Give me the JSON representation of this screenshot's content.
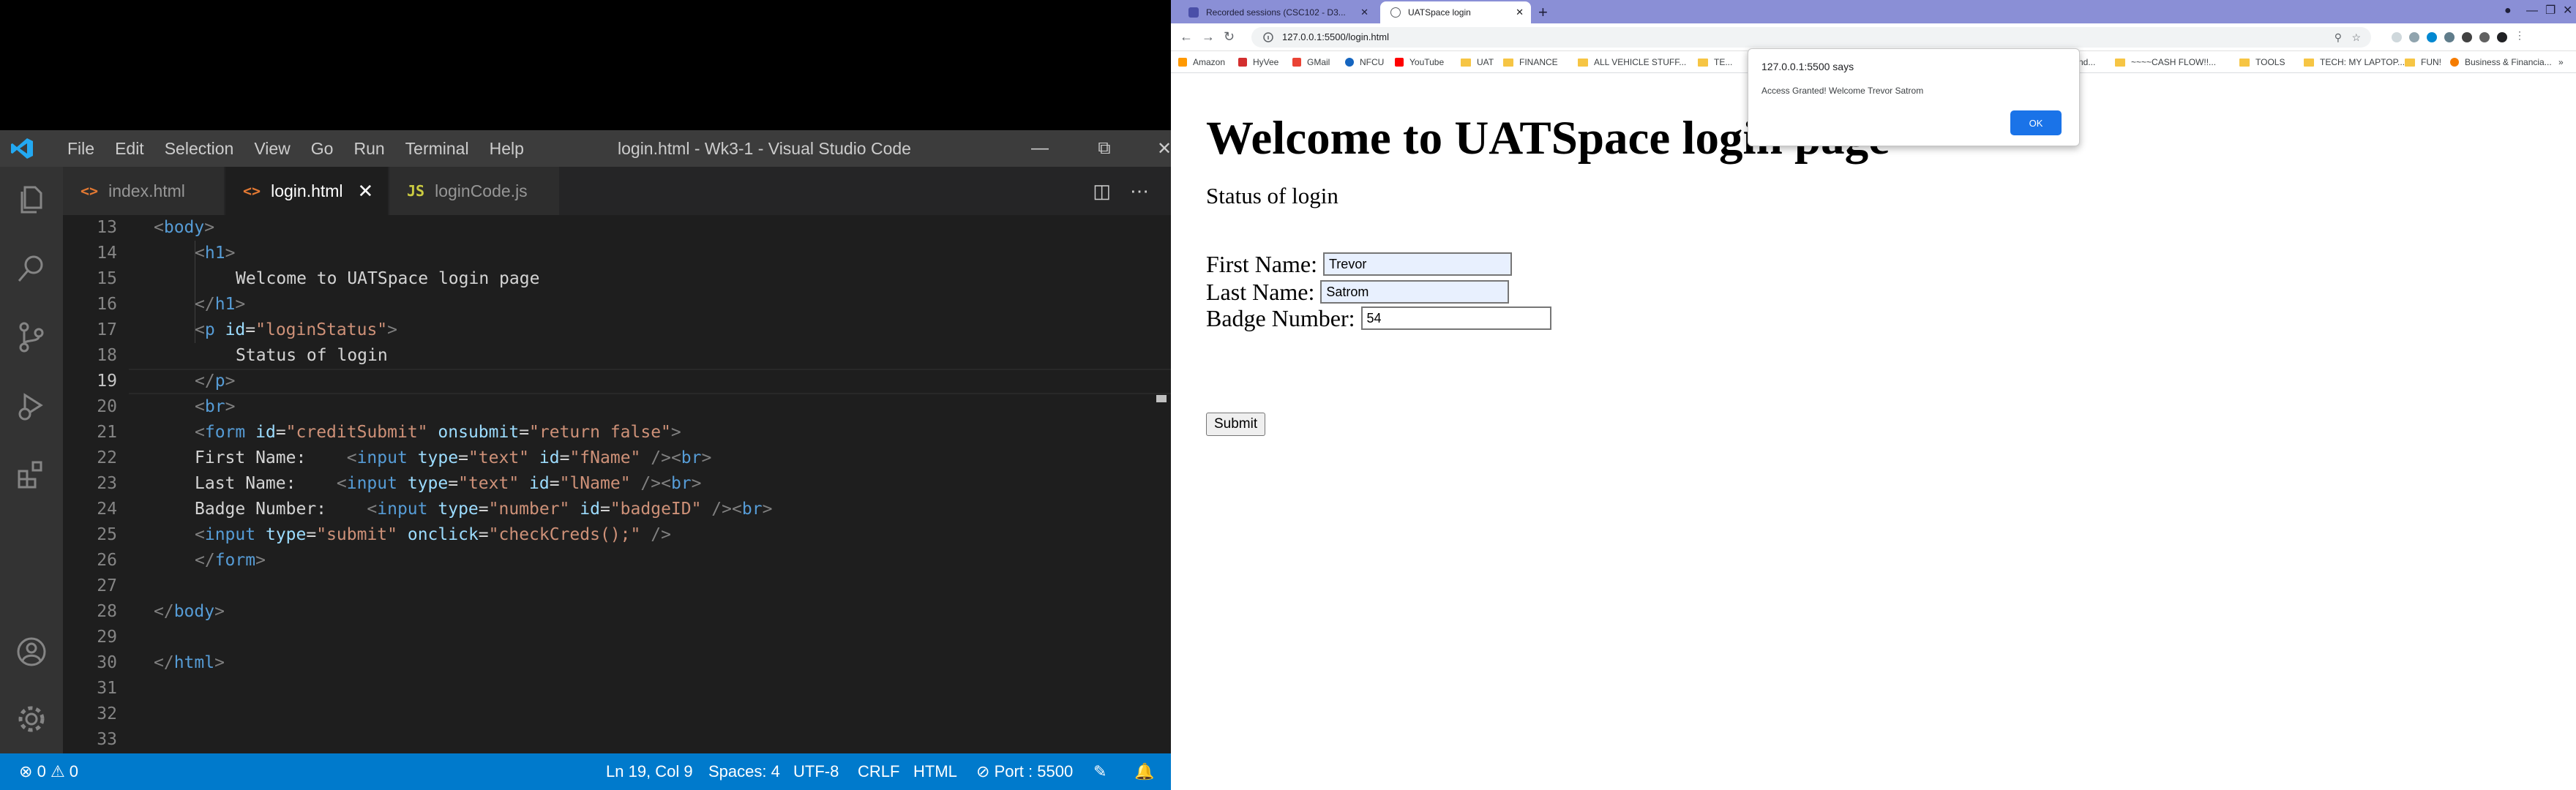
{
  "vscode": {
    "menu": [
      "File",
      "Edit",
      "Selection",
      "View",
      "Go",
      "Run",
      "Terminal",
      "Help"
    ],
    "title": "login.html - Wk3-1 - Visual Studio Code",
    "tabs": [
      {
        "label": "index.html",
        "icon": "<>",
        "icon_color": "#e37933"
      },
      {
        "label": "login.html",
        "icon": "<>",
        "icon_color": "#e37933"
      },
      {
        "label": "loginCode.js",
        "icon": "JS",
        "icon_color": "#cbcb41"
      }
    ],
    "line_numbers": [
      "13",
      "14",
      "15",
      "16",
      "17",
      "18",
      "19",
      "20",
      "21",
      "22",
      "23",
      "24",
      "25",
      "26",
      "27",
      "28",
      "29",
      "30",
      "31",
      "32",
      "33",
      "34"
    ],
    "status": {
      "errors": "0",
      "warnings": "0",
      "position": "Ln 19, Col 9",
      "spaces": "Spaces: 4",
      "encoding": "UTF-8",
      "eol": "CRLF",
      "language": "HTML",
      "port": "Port : 5500"
    },
    "colors": {
      "status_bar": "#007acc",
      "editor_bg": "#1e1e1e",
      "title_bar": "#3c3c3c"
    }
  },
  "code": {
    "l13": {
      "p1": "<",
      "p2": "body",
      "p3": ">"
    },
    "l14": {
      "p1": "<",
      "p2": "h1",
      "p3": ">"
    },
    "l15": {
      "p1": "Welcome to UATSpace login page"
    },
    "l16": {
      "p1": "</",
      "p2": "h1",
      "p3": ">"
    },
    "l17": {
      "p1": "<",
      "p2": "p",
      "p3": " ",
      "p4": "id",
      "p5": "=",
      "p6": "\"loginStatus\"",
      "p7": ">"
    },
    "l18": {
      "p1": "Status of login"
    },
    "l19": {
      "p1": "</",
      "p2": "p",
      "p3": ">"
    },
    "l20": {
      "p1": "<",
      "p2": "br",
      "p3": ">"
    },
    "l21": {
      "p1": "<",
      "p2": "form",
      "p3": " ",
      "p4": "id",
      "p5": "=",
      "p6": "\"creditSubmit\"",
      "p7": " ",
      "p8": "onsubmit",
      "p9": "=",
      "p10": "\"return false\"",
      "p11": ">"
    },
    "l22": {
      "p1": "First Name:    ",
      "p2": "<",
      "p3": "input",
      "p4": " ",
      "p5": "type",
      "p6": "=",
      "p7": "\"text\"",
      "p8": " ",
      "p9": "id",
      "p10": "=",
      "p11": "\"fName\"",
      "p12": " />",
      "p13": "<",
      "p14": "br",
      "p15": ">"
    },
    "l23": {
      "p1": "Last Name:    ",
      "p2": "<",
      "p3": "input",
      "p4": " ",
      "p5": "type",
      "p6": "=",
      "p7": "\"text\"",
      "p8": " ",
      "p9": "id",
      "p10": "=",
      "p11": "\"lName\"",
      "p12": " />",
      "p13": "<",
      "p14": "br",
      "p15": ">"
    },
    "l24": {
      "p1": "Badge Number:    ",
      "p2": "<",
      "p3": "input",
      "p4": " ",
      "p5": "type",
      "p6": "=",
      "p7": "\"number\"",
      "p8": " ",
      "p9": "id",
      "p10": "=",
      "p11": "\"badgeID\"",
      "p12": " />",
      "p13": "<",
      "p14": "br",
      "p15": ">"
    },
    "l25": {
      "p1": "<",
      "p2": "input",
      "p3": " ",
      "p4": "type",
      "p5": "=",
      "p6": "\"submit\"",
      "p7": " ",
      "p8": "onclick",
      "p9": "=",
      "p10": "\"checkCreds();\"",
      "p11": " />"
    },
    "l26": {
      "p1": "</",
      "p2": "form",
      "p3": ">"
    },
    "l28": {
      "p1": "</",
      "p2": "body",
      "p3": ">"
    },
    "l30": {
      "p1": "</",
      "p2": "html",
      "p3": ">"
    }
  },
  "chrome": {
    "tabs": [
      {
        "label": "Recorded sessions (CSC102 - D3..."
      },
      {
        "label": "UATSpace login"
      }
    ],
    "url": "127.0.0.1:5500/login.html",
    "bookmarks": [
      "Amazon",
      "HyVee",
      "GMail",
      "NFCU",
      "YouTube",
      "UAT",
      "FINANCE",
      "ALL VEHICLE STUFF...",
      "TE...",
      "...nd...",
      "~~~~CASH FLOW!!...",
      "TOOLS",
      "TECH: MY LAPTOP...",
      "FUN!",
      "Business & Financia..."
    ],
    "page": {
      "heading": "Welcome to UATSpace login page",
      "status": "Status of login",
      "first_label": "First Name:",
      "first_value": "Trevor",
      "last_label": "Last Name:",
      "last_value": "Satrom",
      "badge_label": "Badge Number:",
      "badge_value": "54",
      "submit_label": "Submit"
    },
    "alert": {
      "title": "127.0.0.1:5500 says",
      "message": "Access Granted! Welcome Trevor Satrom",
      "ok_label": "OK"
    },
    "colors": {
      "tab_bar": "#8a8fd6",
      "alert_button": "#1a73e8"
    }
  }
}
